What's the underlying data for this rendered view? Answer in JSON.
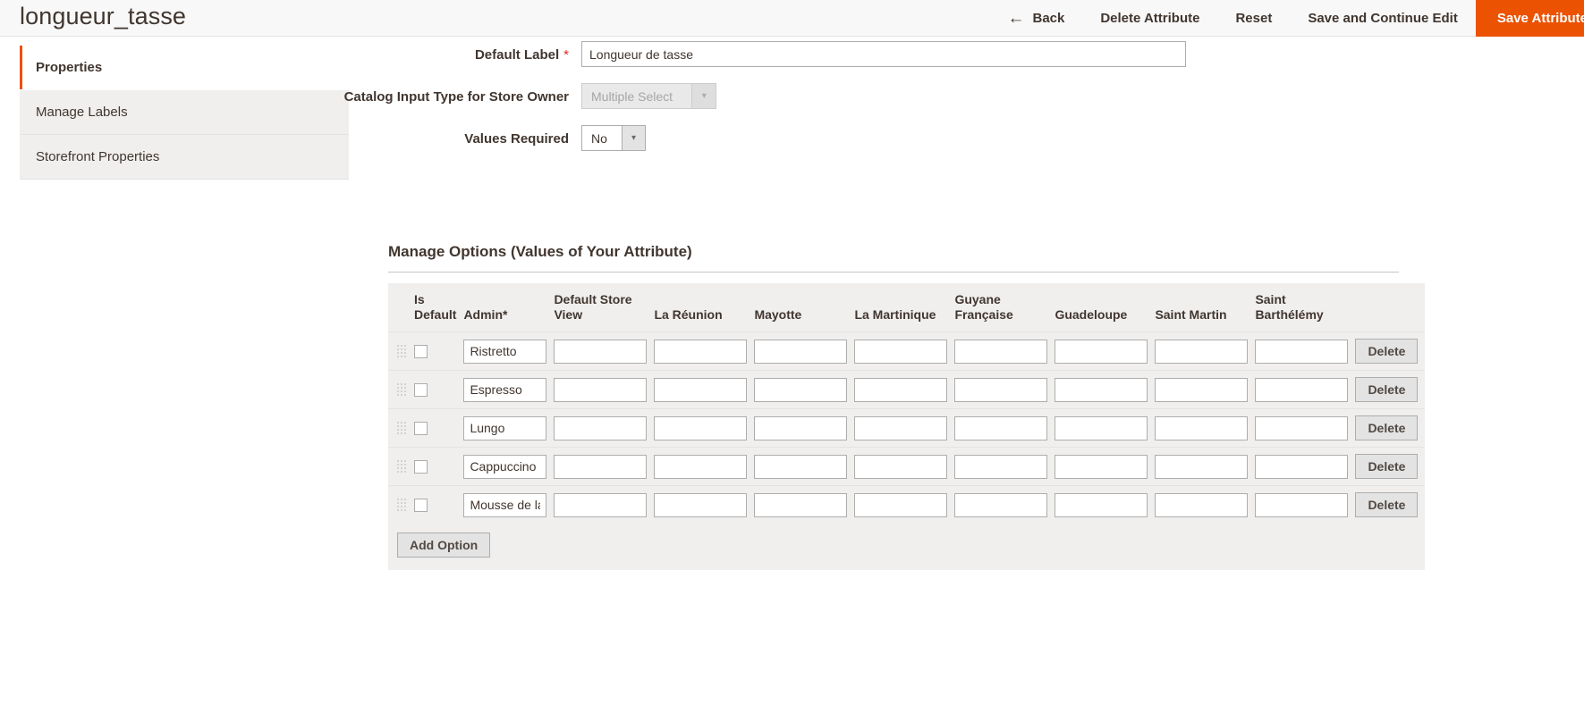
{
  "header": {
    "title": "longueur_tasse",
    "actions": [
      {
        "name": "back-button",
        "label": "Back",
        "icon": "arrow-left-icon",
        "style": "link"
      },
      {
        "name": "delete-attribute-button",
        "label": "Delete Attribute",
        "style": "link"
      },
      {
        "name": "reset-button",
        "label": "Reset",
        "style": "link"
      },
      {
        "name": "save-and-continue-edit-button",
        "label": "Save and Continue Edit",
        "style": "link"
      },
      {
        "name": "save-attribute-button",
        "label": "Save Attribute",
        "style": "primary"
      }
    ],
    "back_arrow_glyph": "←"
  },
  "colors": {
    "accent": "#eb5202",
    "required_asterisk": "#e22626",
    "text": "#41362f",
    "panel": "#f0efee"
  },
  "tabs": [
    {
      "name": "sidebar-item-properties",
      "label": "Properties",
      "active": true
    },
    {
      "name": "sidebar-item-manage-labels",
      "label": "Manage Labels",
      "active": false
    },
    {
      "name": "sidebar-item-storefront-properties",
      "label": "Storefront Properties",
      "active": false
    }
  ],
  "form": {
    "default_label": {
      "label": "Default Label",
      "required_marker": "*",
      "value": "Longueur de tasse",
      "placeholder": ""
    },
    "catalog_input_type": {
      "label": "Catalog Input Type for Store Owner",
      "value": "Multiple Select",
      "disabled": true,
      "arrow_glyph": "▾"
    },
    "values_required": {
      "label": "Values Required",
      "value": "No",
      "disabled": false,
      "arrow_glyph": "▾"
    }
  },
  "manage_options": {
    "title": "Manage Options (Values of Your Attribute)",
    "columns": [
      {
        "name": "column-drag",
        "label": ""
      },
      {
        "name": "column-is-default",
        "label": "Is Default"
      },
      {
        "name": "column-admin",
        "label": "Admin",
        "required_marker": "*"
      },
      {
        "name": "column-default-store-view",
        "label": "Default Store View"
      },
      {
        "name": "column-la-reunion",
        "label": "La Réunion"
      },
      {
        "name": "column-mayotte",
        "label": "Mayotte"
      },
      {
        "name": "column-la-martinique",
        "label": "La Martinique"
      },
      {
        "name": "column-guyane-francaise",
        "label": "Guyane Française"
      },
      {
        "name": "column-guadeloupe",
        "label": "Guadeloupe"
      },
      {
        "name": "column-saint-martin",
        "label": "Saint Martin"
      },
      {
        "name": "column-saint-barthelemy",
        "label": "Saint Barthélémy"
      },
      {
        "name": "column-actions",
        "label": ""
      }
    ],
    "rows": [
      {
        "is_default": false,
        "admin": "Ristretto",
        "default_store_view": "",
        "la_reunion": "",
        "mayotte": "",
        "la_martinique": "",
        "guyane_francaise": "",
        "guadeloupe": "",
        "saint_martin": "",
        "saint_barthelemy": "",
        "delete_label": "Delete"
      },
      {
        "is_default": false,
        "admin": "Espresso",
        "default_store_view": "",
        "la_reunion": "",
        "mayotte": "",
        "la_martinique": "",
        "guyane_francaise": "",
        "guadeloupe": "",
        "saint_martin": "",
        "saint_barthelemy": "",
        "delete_label": "Delete"
      },
      {
        "is_default": false,
        "admin": "Lungo",
        "default_store_view": "",
        "la_reunion": "",
        "mayotte": "",
        "la_martinique": "",
        "guyane_francaise": "",
        "guadeloupe": "",
        "saint_martin": "",
        "saint_barthelemy": "",
        "delete_label": "Delete"
      },
      {
        "is_default": false,
        "admin": "Cappuccino",
        "default_store_view": "",
        "la_reunion": "",
        "mayotte": "",
        "la_martinique": "",
        "guyane_francaise": "",
        "guadeloupe": "",
        "saint_martin": "",
        "saint_barthelemy": "",
        "delete_label": "Delete"
      },
      {
        "is_default": false,
        "admin": "Mousse de la",
        "default_store_view": "",
        "la_reunion": "",
        "mayotte": "",
        "la_martinique": "",
        "guyane_francaise": "",
        "guadeloupe": "",
        "saint_martin": "",
        "saint_barthelemy": "",
        "delete_label": "Delete"
      }
    ],
    "add_option_label": "Add Option"
  }
}
